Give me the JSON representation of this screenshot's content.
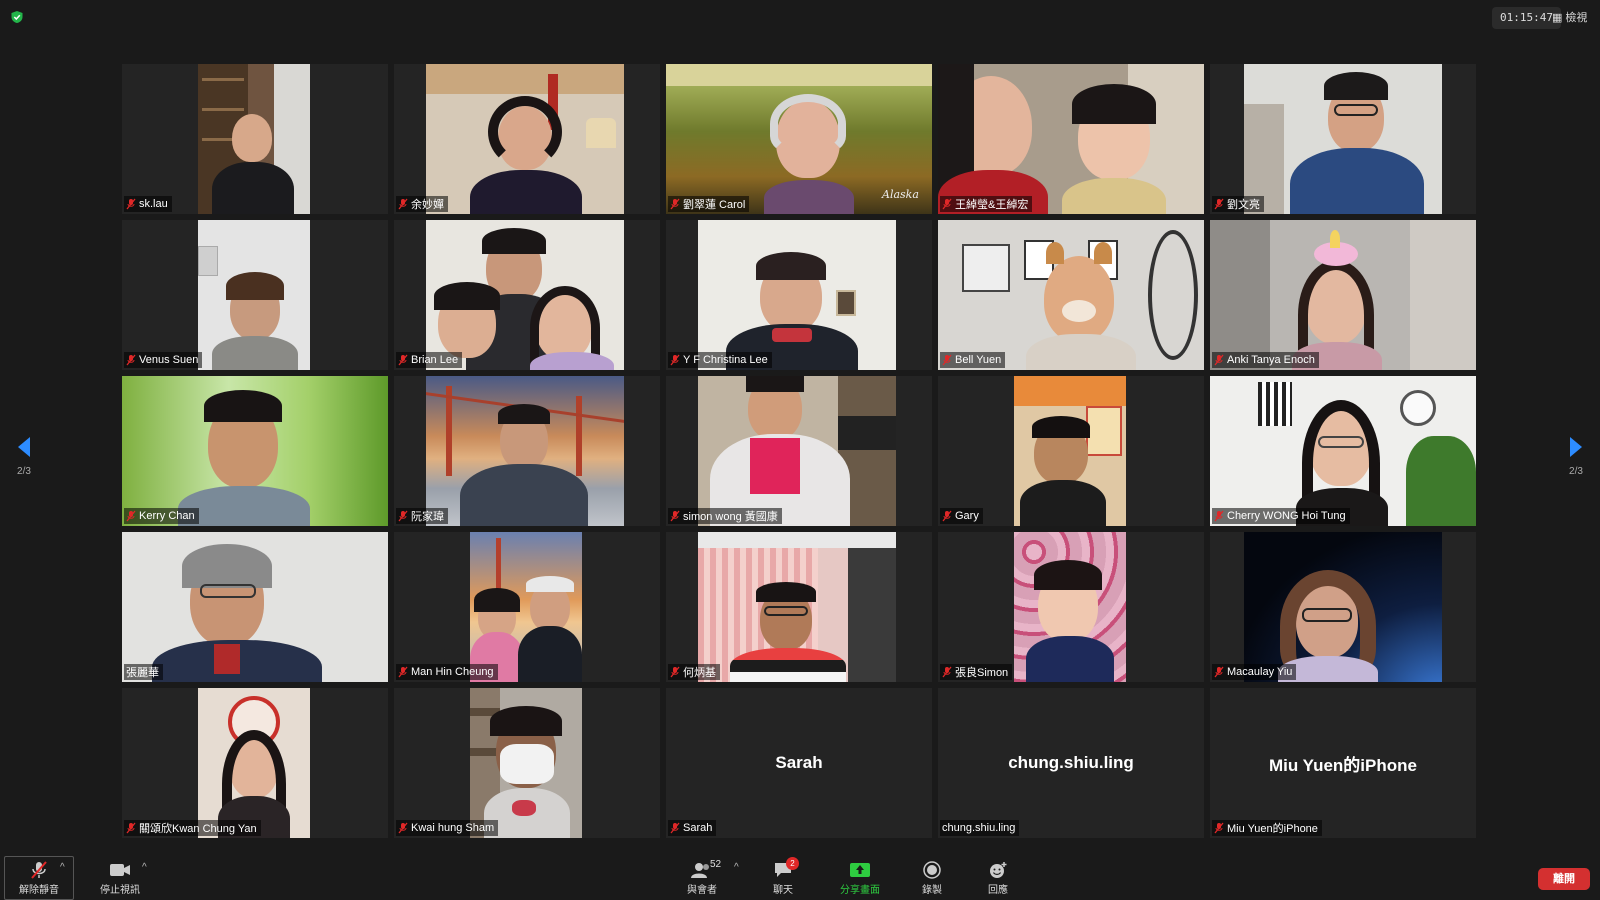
{
  "header": {
    "timer": "01:15:47",
    "view_label": "檢視"
  },
  "pager": {
    "left_page": "2/3",
    "right_page": "2/3"
  },
  "participants": [
    {
      "name": "sk.lau"
    },
    {
      "name": "余妙嬋"
    },
    {
      "name": "劉翠蓮 Carol"
    },
    {
      "name": "王綽瑩&王綽宏"
    },
    {
      "name": "劉文亮"
    },
    {
      "name": "Venus Suen"
    },
    {
      "name": "Brian Lee"
    },
    {
      "name": "Y F Christina Lee"
    },
    {
      "name": "Bell Yuen"
    },
    {
      "name": "Anki Tanya Enoch"
    },
    {
      "name": "Kerry Chan"
    },
    {
      "name": "阮家瑋"
    },
    {
      "name": "simon wong 黃國康"
    },
    {
      "name": "Gary"
    },
    {
      "name": "Cherry WONG Hoi Tung"
    },
    {
      "name": "張麗華"
    },
    {
      "name": "Man Hin Cheung"
    },
    {
      "name": "何炳基"
    },
    {
      "name": "張良Simon"
    },
    {
      "name": "Macaulay Yiu"
    },
    {
      "name": "關頌欣Kwan Chung Yan"
    },
    {
      "name": "Kwai hung Sham"
    },
    {
      "name": "Sarah",
      "center": "Sarah"
    },
    {
      "name": "chung.shiu.ling",
      "center": "chung.shiu.ling"
    },
    {
      "name": "Miu Yuen的iPhone",
      "center": "Miu Yuen的iPhone"
    }
  ],
  "toolbar": {
    "mute_label": "解除靜音",
    "video_label": "停止視訊",
    "participants_label": "與會者",
    "participants_count": "52",
    "chat_label": "聊天",
    "chat_badge": "2",
    "share_label": "分享畫面",
    "record_label": "錄製",
    "reactions_label": "回應",
    "leave_label": "離開"
  },
  "colors": {
    "background": "#1a1a1a",
    "tile": "#242424",
    "accent_blue": "#2d8cff",
    "share_green": "#2ecc40",
    "leave_red": "#d43030",
    "mic_off_red": "#e02828"
  }
}
